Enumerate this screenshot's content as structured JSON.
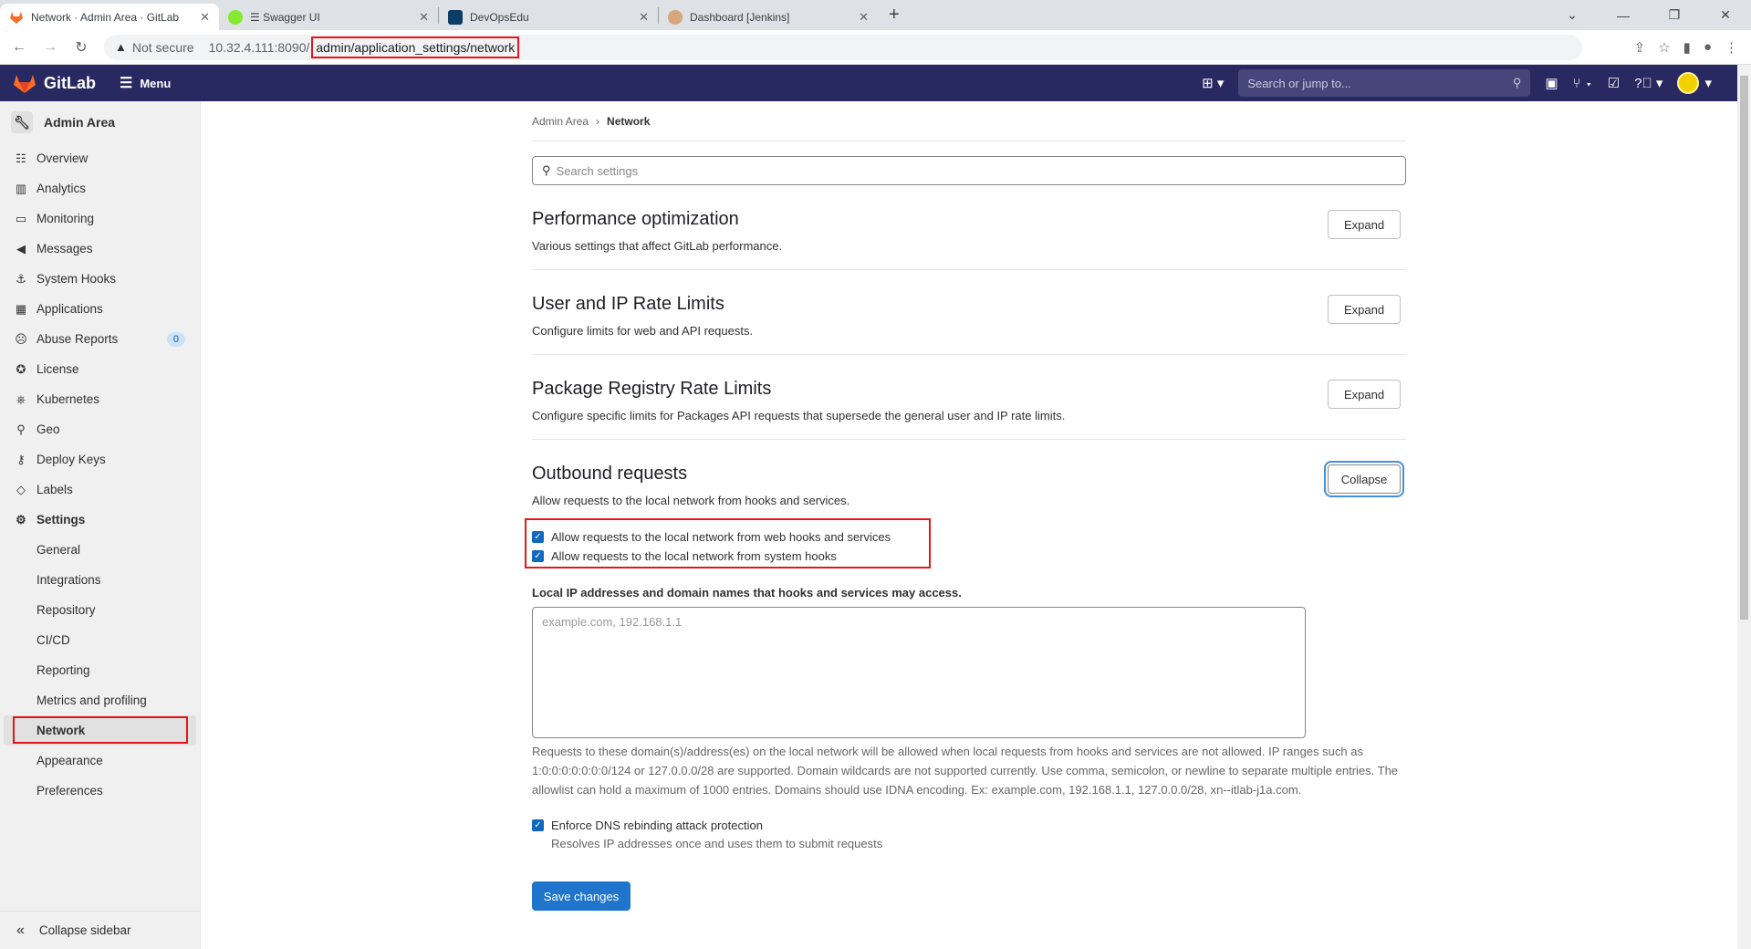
{
  "browser": {
    "tabs": [
      {
        "title": "Network · Admin Area · GitLab",
        "active": true
      },
      {
        "title": "☰ Swagger UI",
        "active": false
      },
      {
        "title": "DevOpsEdu",
        "active": false
      },
      {
        "title": "Dashboard [Jenkins]",
        "active": false
      }
    ],
    "not_secure": "Not secure",
    "host": "10.32.4.111:8090/",
    "path": "admin/application_settings/network"
  },
  "navbar": {
    "brand": "GitLab",
    "menu_label": "Menu",
    "search_placeholder": "Search or jump to..."
  },
  "sidebar": {
    "title": "Admin Area",
    "items": [
      {
        "label": "Overview",
        "icon": "overview-icon"
      },
      {
        "label": "Analytics",
        "icon": "chart-icon"
      },
      {
        "label": "Monitoring",
        "icon": "monitor-icon"
      },
      {
        "label": "Messages",
        "icon": "bullhorn-icon"
      },
      {
        "label": "System Hooks",
        "icon": "hook-icon"
      },
      {
        "label": "Applications",
        "icon": "applications-icon"
      },
      {
        "label": "Abuse Reports",
        "icon": "abuse-icon",
        "badge": "0"
      },
      {
        "label": "License",
        "icon": "license-icon"
      },
      {
        "label": "Kubernetes",
        "icon": "kubernetes-icon"
      },
      {
        "label": "Geo",
        "icon": "location-icon"
      },
      {
        "label": "Deploy Keys",
        "icon": "key-icon"
      },
      {
        "label": "Labels",
        "icon": "label-icon"
      },
      {
        "label": "Settings",
        "icon": "settings-icon"
      }
    ],
    "settings_subitems": [
      "General",
      "Integrations",
      "Repository",
      "CI/CD",
      "Reporting",
      "Metrics and profiling",
      "Network",
      "Appearance",
      "Preferences"
    ],
    "active_subitem": "Network",
    "collapse_label": "Collapse sidebar"
  },
  "main": {
    "breadcrumb": {
      "parent": "Admin Area",
      "current": "Network"
    },
    "search_placeholder": "Search settings",
    "sections": [
      {
        "title": "Performance optimization",
        "description": "Various settings that affect GitLab performance.",
        "button": "Expand"
      },
      {
        "title": "User and IP Rate Limits",
        "description": "Configure limits for web and API requests.",
        "button": "Expand"
      },
      {
        "title": "Package Registry Rate Limits",
        "description": "Configure specific limits for Packages API requests that supersede the general user and IP rate limits.",
        "button": "Expand"
      }
    ],
    "outbound": {
      "title": "Outbound requests",
      "description": "Allow requests to the local network from hooks and services.",
      "button": "Collapse",
      "checkbox_webhooks": "Allow requests to the local network from web hooks and services",
      "checkbox_system_hooks": "Allow requests to the local network from system hooks",
      "allowlist_label": "Local IP addresses and domain names that hooks and services may access.",
      "allowlist_placeholder": "example.com, 192.168.1.1",
      "allowlist_help": "Requests to these domain(s)/address(es) on the local network will be allowed when local requests from hooks and services are not allowed. IP ranges such as 1:0:0:0:0:0:0:0/124 or 127.0.0.0/28 are supported. Domain wildcards are not supported currently. Use comma, semicolon, or newline to separate multiple entries. The allowlist can hold a maximum of 1000 entries. Domains should use IDNA encoding. Ex: example.com, 192.168.1.1, 127.0.0.0/28, xn--itlab-j1a.com.",
      "dns_label": "Enforce DNS rebinding attack protection",
      "dns_help": "Resolves IP addresses once and uses them to submit requests",
      "save_button": "Save changes"
    }
  },
  "colors": {
    "navbar": "#292961",
    "primary": "#1f75cb",
    "highlight": "#e3161b"
  }
}
